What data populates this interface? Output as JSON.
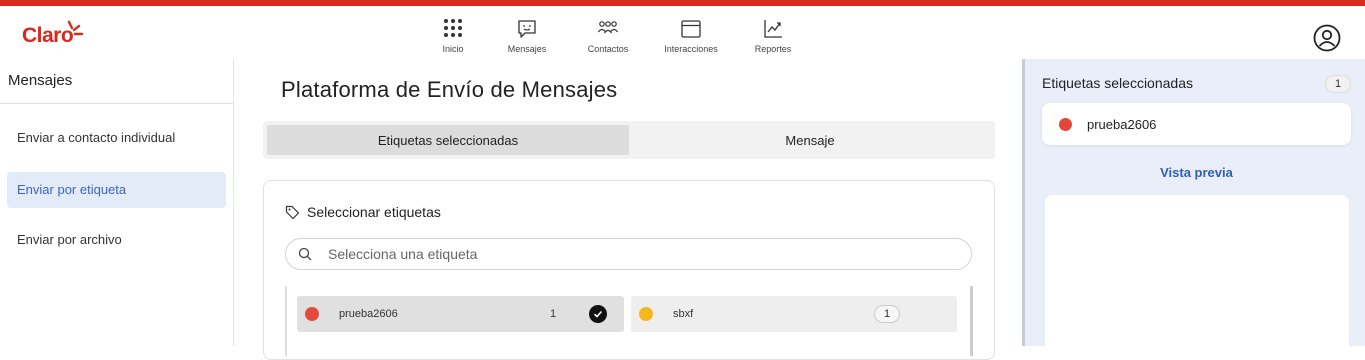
{
  "app": {
    "logo": "Claro"
  },
  "nav": [
    {
      "label": "Inicio",
      "icon": "grid-icon"
    },
    {
      "label": "Mensajes",
      "icon": "message-icon"
    },
    {
      "label": "Contactos",
      "icon": "contacts-icon"
    },
    {
      "label": "Interacciones",
      "icon": "window-icon"
    },
    {
      "label": "Reportes",
      "icon": "chart-icon"
    }
  ],
  "sidebar": {
    "title": "Mensajes",
    "items": [
      {
        "label": "Enviar a contacto individual",
        "active": false
      },
      {
        "label": "Enviar por etiqueta",
        "active": true
      },
      {
        "label": "Enviar por archivo",
        "active": false
      }
    ]
  },
  "main": {
    "title": "Plataforma de Envío de Mensajes",
    "tabs": [
      {
        "label": "Etiquetas seleccionadas",
        "active": true
      },
      {
        "label": "Mensaje",
        "active": false
      }
    ],
    "card": {
      "title": "Seleccionar etiquetas",
      "search_placeholder": "Selecciona una etiqueta",
      "tags": [
        {
          "name": "prueba2606",
          "count": "1",
          "color": "#e24b3b",
          "selected": true
        },
        {
          "name": "sbxf",
          "count": "1",
          "color": "#f5b81c",
          "selected": false
        }
      ]
    }
  },
  "right_panel": {
    "title": "Etiquetas seleccionadas",
    "count": "1",
    "selected_tag": {
      "name": "prueba2606",
      "color": "#e0473a"
    },
    "preview_label": "Vista previa"
  },
  "colors": {
    "brand": "#da291c",
    "accent": "#2e5fbf",
    "active_bg": "#e3ebf8"
  }
}
